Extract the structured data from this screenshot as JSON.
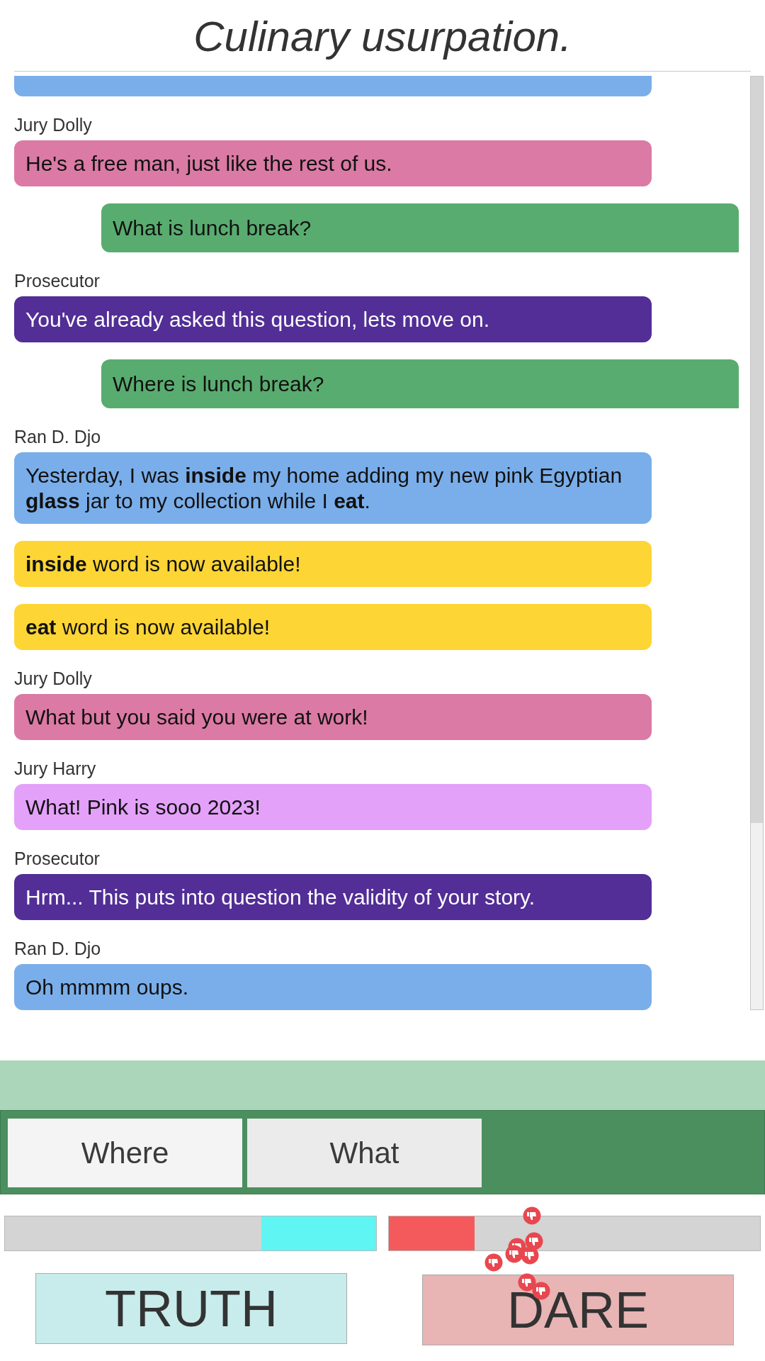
{
  "title": "Culinary usurpation.",
  "messages": [
    {
      "kind": "left",
      "color": "#7aaeea"
    },
    {
      "kind": "left",
      "speaker": "Jury Dolly",
      "color": "#db7aa4",
      "text": "He's a free man, just like the rest of us."
    },
    {
      "kind": "right",
      "color": "#59ac6f",
      "text": "What is lunch break?"
    },
    {
      "kind": "left",
      "speaker": "Prosecutor",
      "color": "#522e96",
      "text": "You've already asked this question, lets move on."
    },
    {
      "kind": "right",
      "color": "#59ac6f",
      "text": "Where is lunch break?"
    },
    {
      "kind": "left",
      "speaker": "Ran D. Djo",
      "color": "#7aaeea",
      "text": "Yesterday, I was **inside** my home adding my new pink Egyptian **glass** jar to my collection while I **eat**."
    },
    {
      "kind": "notice",
      "color": "#fdd535",
      "text": "**inside** word is now available!"
    },
    {
      "kind": "notice",
      "color": "#fdd535",
      "text": "**eat** word is now available!"
    },
    {
      "kind": "left",
      "speaker": "Jury Dolly",
      "color": "#db7aa4",
      "text": "What but you said you were at work!"
    },
    {
      "kind": "left",
      "speaker": "Jury Harry",
      "color": "#e3a1f9",
      "text": "What! Pink is sooo 2023!"
    },
    {
      "kind": "left",
      "speaker": "Prosecutor",
      "color": "#522e96",
      "text": "Hrm... This puts into question the validity of your story."
    },
    {
      "kind": "left",
      "speaker": "Ran D. Djo",
      "color": "#7aaeea",
      "text": "Oh mmmm oups."
    }
  ],
  "words": [
    "Where",
    "What"
  ],
  "meters": [
    {
      "kind": "truth",
      "color": "#5ff5f3",
      "level": 0.31
    },
    {
      "kind": "dare",
      "color": "#f45a5c",
      "level": 0.23
    }
  ],
  "buttons": [
    {
      "kind": "truth",
      "label": "TRUTH"
    },
    {
      "kind": "dare",
      "label": "DARE"
    }
  ]
}
